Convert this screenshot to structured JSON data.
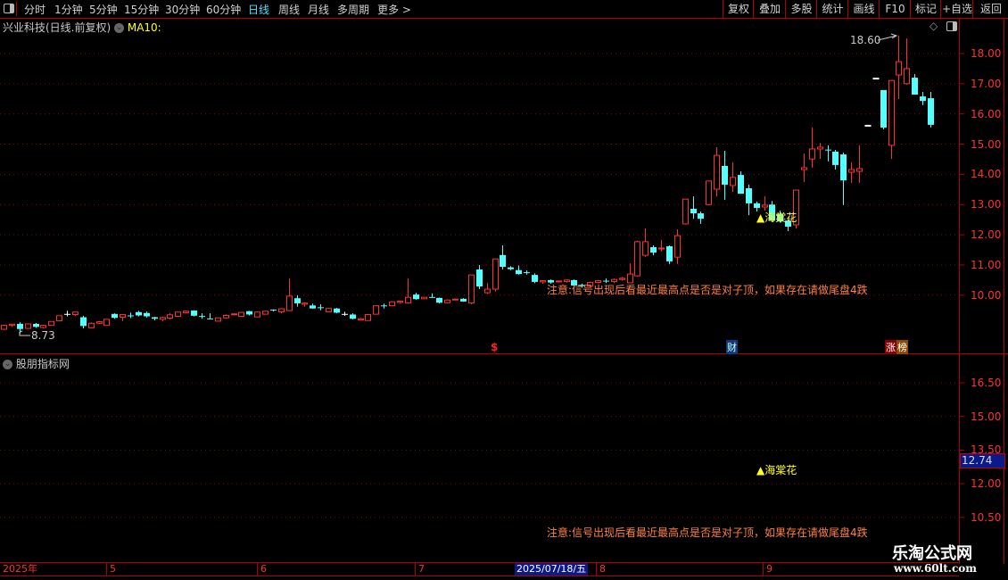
{
  "toolbar": {
    "periods": [
      "分时",
      "1分钟",
      "5分钟",
      "15分钟",
      "30分钟",
      "60分钟",
      "日线",
      "周线",
      "月线",
      "多周期",
      "更多 >"
    ],
    "active_period": "日线",
    "buttons": [
      "复权",
      "叠加",
      "多股",
      "统计",
      "画线",
      "F10",
      "标记",
      "+自选",
      "返回"
    ]
  },
  "main_chart": {
    "title": "兴业科技(日线.前复权)",
    "indicator": "MA10:",
    "price_labels": [
      "18.00",
      "17.00",
      "16.00",
      "15.00",
      "14.00",
      "13.00",
      "12.00",
      "11.00",
      "10.00"
    ],
    "price_values": [
      18,
      17,
      16,
      15,
      14,
      13,
      12,
      11,
      10
    ],
    "high_annotation": "18.60",
    "low_annotation": "8.73",
    "signal_label": "▲海棠花",
    "warning_text": "注意:信号出现后看最近最高点是否是对子顶，如果存在请做尾盘4跌",
    "markers": {
      "dollar": "$",
      "finance": "财",
      "rank_1": "涨",
      "rank_2": "榜"
    },
    "colors": {
      "up": "#ff3030",
      "down": "#54ffff",
      "flat": "#ffffff",
      "grid": "#8a0000",
      "axis": "#b00000"
    },
    "candles": [
      [
        8.87,
        9.02,
        8.85,
        9.0
      ],
      [
        9.0,
        9.04,
        8.95,
        9.04
      ],
      [
        9.05,
        9.1,
        8.73,
        8.88
      ],
      [
        8.9,
        9.06,
        8.88,
        9.05
      ],
      [
        9.05,
        9.08,
        8.92,
        8.95
      ],
      [
        8.93,
        9.02,
        8.9,
        9.0
      ],
      [
        9.0,
        9.14,
        9.0,
        9.13
      ],
      [
        9.15,
        9.32,
        9.15,
        9.32
      ],
      [
        9.38,
        9.48,
        9.3,
        9.38
      ],
      [
        9.36,
        9.45,
        9.32,
        9.44
      ],
      [
        9.27,
        9.32,
        8.9,
        8.98
      ],
      [
        8.92,
        9.1,
        8.9,
        9.07
      ],
      [
        9.07,
        9.15,
        9.05,
        9.12
      ],
      [
        9.0,
        9.2,
        9.0,
        9.2
      ],
      [
        9.38,
        9.4,
        9.22,
        9.25
      ],
      [
        9.27,
        9.38,
        9.14,
        9.36
      ],
      [
        9.33,
        9.42,
        9.24,
        9.31
      ],
      [
        9.44,
        9.48,
        9.3,
        9.33
      ],
      [
        9.41,
        9.46,
        9.26,
        9.3
      ],
      [
        9.27,
        9.28,
        9.17,
        9.22
      ],
      [
        9.2,
        9.28,
        9.14,
        9.26
      ],
      [
        9.24,
        9.4,
        9.2,
        9.35
      ],
      [
        9.3,
        9.45,
        9.3,
        9.44
      ],
      [
        9.42,
        9.49,
        9.4,
        9.47
      ],
      [
        9.49,
        9.5,
        9.3,
        9.32
      ],
      [
        9.31,
        9.4,
        9.22,
        9.3
      ],
      [
        9.23,
        9.4,
        9.22,
        9.22
      ],
      [
        9.14,
        9.26,
        9.14,
        9.25
      ],
      [
        9.25,
        9.36,
        9.22,
        9.33
      ],
      [
        9.35,
        9.4,
        9.33,
        9.38
      ],
      [
        9.3,
        9.44,
        9.3,
        9.43
      ],
      [
        9.47,
        9.48,
        9.33,
        9.36
      ],
      [
        9.28,
        9.46,
        9.28,
        9.44
      ],
      [
        9.37,
        9.48,
        9.37,
        9.47
      ],
      [
        9.52,
        9.53,
        9.46,
        9.5
      ],
      [
        9.45,
        9.57,
        9.4,
        9.55
      ],
      [
        9.49,
        10.55,
        9.49,
        9.97
      ],
      [
        9.9,
        10.0,
        9.62,
        9.73
      ],
      [
        9.7,
        9.76,
        9.62,
        9.74
      ],
      [
        9.66,
        9.72,
        9.55,
        9.56
      ],
      [
        9.6,
        9.7,
        9.5,
        9.58
      ],
      [
        9.45,
        9.58,
        9.45,
        9.56
      ],
      [
        9.56,
        9.58,
        9.4,
        9.42
      ],
      [
        9.38,
        9.45,
        9.32,
        9.38
      ],
      [
        9.36,
        9.4,
        9.2,
        9.22
      ],
      [
        9.18,
        9.25,
        9.17,
        9.22
      ],
      [
        9.16,
        9.38,
        9.16,
        9.36
      ],
      [
        9.37,
        9.66,
        9.37,
        9.65
      ],
      [
        9.66,
        9.72,
        9.56,
        9.65
      ],
      [
        9.65,
        9.8,
        9.64,
        9.78
      ],
      [
        9.76,
        9.82,
        9.72,
        9.8
      ],
      [
        9.74,
        10.55,
        9.72,
        9.93
      ],
      [
        10.02,
        10.08,
        9.85,
        9.87
      ],
      [
        9.88,
        9.94,
        9.88,
        9.93
      ],
      [
        9.94,
        10.06,
        9.93,
        9.93
      ],
      [
        9.91,
        9.92,
        9.73,
        9.75
      ],
      [
        9.75,
        9.86,
        9.73,
        9.84
      ],
      [
        9.84,
        9.88,
        9.84,
        9.87
      ],
      [
        9.88,
        9.9,
        9.78,
        9.79
      ],
      [
        9.74,
        10.67,
        9.7,
        10.67
      ],
      [
        10.85,
        11.0,
        10.2,
        10.29
      ],
      [
        10.08,
        10.4,
        10.04,
        10.2
      ],
      [
        10.2,
        11.2,
        10.12,
        11.2
      ],
      [
        11.33,
        11.65,
        10.85,
        10.94
      ],
      [
        10.92,
        10.96,
        10.83,
        10.86
      ],
      [
        10.83,
        10.98,
        10.68,
        10.7
      ],
      [
        10.76,
        10.82,
        10.68,
        10.75
      ],
      [
        10.67,
        10.72,
        10.4,
        10.44
      ],
      [
        10.44,
        10.48,
        10.38,
        10.48
      ],
      [
        10.5,
        10.52,
        10.38,
        10.42
      ],
      [
        10.44,
        10.48,
        10.42,
        10.47
      ],
      [
        10.45,
        10.52,
        10.42,
        10.5
      ],
      [
        10.5,
        10.52,
        10.3,
        10.32
      ],
      [
        10.34,
        10.38,
        10.25,
        10.3
      ],
      [
        10.3,
        10.45,
        10.28,
        10.42
      ],
      [
        10.42,
        10.5,
        10.4,
        10.48
      ],
      [
        10.48,
        10.55,
        10.4,
        10.47
      ],
      [
        10.45,
        10.55,
        10.4,
        10.52
      ],
      [
        10.52,
        10.6,
        10.48,
        10.56
      ],
      [
        10.41,
        11.05,
        10.4,
        10.7
      ],
      [
        10.64,
        11.8,
        10.62,
        11.77
      ],
      [
        11.32,
        12.21,
        11.27,
        11.77
      ],
      [
        11.59,
        11.65,
        11.32,
        11.41
      ],
      [
        11.53,
        11.83,
        11.44,
        11.56
      ],
      [
        11.62,
        11.65,
        11.03,
        11.12
      ],
      [
        11.26,
        12.18,
        11.03,
        11.97
      ],
      [
        12.36,
        13.18,
        12.34,
        13.18
      ],
      [
        12.86,
        13.27,
        12.53,
        12.71
      ],
      [
        12.71,
        12.77,
        12.36,
        12.53
      ],
      [
        13.0,
        13.78,
        12.98,
        13.78
      ],
      [
        13.51,
        14.9,
        13.27,
        14.63
      ],
      [
        14.28,
        14.78,
        13.16,
        13.66
      ],
      [
        13.63,
        14.4,
        13.42,
        13.9
      ],
      [
        13.98,
        14.1,
        13.36,
        13.36
      ],
      [
        13.54,
        13.66,
        12.65,
        13.04
      ],
      [
        13.04,
        13.1,
        12.77,
        12.89
      ],
      [
        12.92,
        13.27,
        12.8,
        12.98
      ],
      [
        13.0,
        13.12,
        12.45,
        12.47
      ],
      [
        12.68,
        12.8,
        12.4,
        12.44
      ],
      [
        12.47,
        12.5,
        12.12,
        12.27
      ],
      [
        12.33,
        13.48,
        12.21,
        13.48
      ],
      [
        14.16,
        14.69,
        13.75,
        14.22
      ],
      [
        14.51,
        15.55,
        14.22,
        14.84
      ],
      [
        14.84,
        15.04,
        14.51,
        14.9
      ],
      [
        14.82,
        14.96,
        14.43,
        14.8
      ],
      [
        14.75,
        14.81,
        14.16,
        14.31
      ],
      [
        14.66,
        14.72,
        12.98,
        13.8
      ],
      [
        14.07,
        14.4,
        13.72,
        14.16
      ],
      [
        14.1,
        14.96,
        13.72,
        14.19
      ],
      [
        15.61,
        15.61,
        15.61,
        15.61
      ],
      [
        17.17,
        17.17,
        17.17,
        17.17
      ],
      [
        16.79,
        16.79,
        15.49,
        15.55
      ],
      [
        14.96,
        17.11,
        14.51,
        17.11
      ],
      [
        17.29,
        18.6,
        16.49,
        17.73
      ],
      [
        17.0,
        18.5,
        16.97,
        17.5
      ],
      [
        17.2,
        17.32,
        16.64,
        16.64
      ],
      [
        16.58,
        16.73,
        16.29,
        16.43
      ],
      [
        16.52,
        16.73,
        15.55,
        15.64
      ]
    ]
  },
  "sub_chart": {
    "title": "股朋指标网",
    "price_labels": [
      "16.50",
      "15.00",
      "13.50",
      "12.00",
      "10.50"
    ],
    "price_values": [
      16.5,
      15,
      13.5,
      12,
      10.5
    ],
    "cursor_price": "12.74",
    "signal_label": "▲海棠花",
    "warning_text": "注意:信号出现后看最近最高点是否是对子顶，如果存在请做尾盘4跌"
  },
  "date_axis": {
    "labels": [
      "2025年",
      "5",
      "6",
      "7",
      "8",
      "9"
    ],
    "cursor_date": "2025/07/18/五"
  },
  "watermark": {
    "name": "乐淘公式网",
    "url": "www.60lt.com"
  }
}
